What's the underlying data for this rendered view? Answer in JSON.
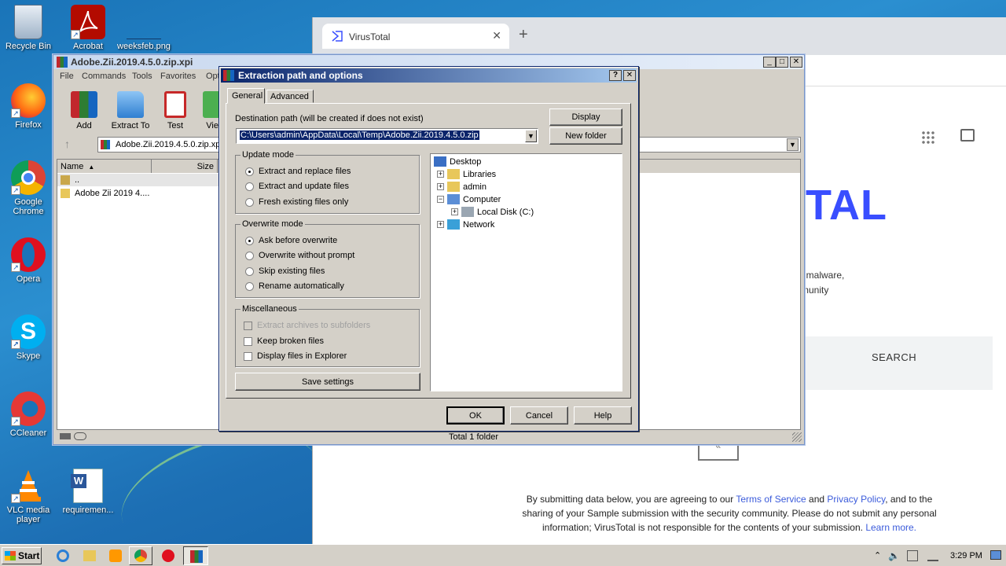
{
  "desktop": {
    "icons": [
      {
        "label": "Recycle Bin",
        "icon": "recycle-bin-icon"
      },
      {
        "label": "Acrobat",
        "icon": "acrobat-icon"
      },
      {
        "label": "weeksfeb.png",
        "icon": "image-file-icon"
      },
      {
        "label": "Firefox",
        "icon": "firefox-icon"
      },
      {
        "label": "Google Chrome",
        "icon": "chrome-icon"
      },
      {
        "label": "Opera",
        "icon": "opera-icon"
      },
      {
        "label": "Skype",
        "icon": "skype-icon"
      },
      {
        "label": "CCleaner",
        "icon": "ccleaner-icon"
      },
      {
        "label": "VLC media player",
        "icon": "vlc-icon"
      },
      {
        "label": "requiremen...",
        "icon": "word-doc-icon"
      }
    ]
  },
  "browser": {
    "tab_title": "VirusTotal",
    "logo_text": "TAL",
    "text1": "f malware,",
    "text2": "munity",
    "search_label": "SEARCH",
    "footer_line1_a": "By submitting data below, you are agreeing to our ",
    "footer_tos": "Terms of Service",
    "footer_and": " and ",
    "footer_privacy": "Privacy Policy",
    "footer_line1_b": ", and to the",
    "footer_line2": "sharing of your Sample submission with the security community. Please do not submit any personal",
    "footer_line3_a": "information; VirusTotal is not responsible for the contents of your submission. ",
    "footer_learn": "Learn more."
  },
  "winrar": {
    "title": "Adobe.Zii.2019.4.5.0.zip.xpi",
    "menu": [
      "File",
      "Commands",
      "Tools",
      "Favorites",
      "Opti"
    ],
    "toolbar": [
      {
        "label": "Add",
        "icon": "add-archive-icon"
      },
      {
        "label": "Extract To",
        "icon": "extract-folder-icon"
      },
      {
        "label": "Test",
        "icon": "test-clipboard-icon"
      },
      {
        "label": "Vie",
        "icon": "view-book-icon"
      }
    ],
    "path": "Adobe.Zii.2019.4.5.0.zip.xp",
    "columns": {
      "name": "Name",
      "size": "Size"
    },
    "files": [
      {
        "name": ".."
      },
      {
        "name": "Adobe Zii 2019 4...."
      }
    ],
    "status": "Total 1 folder"
  },
  "dialog": {
    "title": "Extraction path and options",
    "help_btn": "?",
    "close_btn": "✕",
    "tabs": [
      "General",
      "Advanced"
    ],
    "dest_label": "Destination path (will be created if does not exist)",
    "dest_value": "C:\\Users\\admin\\AppData\\Local\\Temp\\Adobe.Zii.2019.4.5.0.zip",
    "display_btn": "Display",
    "new_folder_btn": "New folder",
    "update_mode": {
      "title": "Update mode",
      "options": [
        "Extract and replace files",
        "Extract and update files",
        "Fresh existing files only"
      ],
      "selected": 0
    },
    "overwrite_mode": {
      "title": "Overwrite mode",
      "options": [
        "Ask before overwrite",
        "Overwrite without prompt",
        "Skip existing files",
        "Rename automatically"
      ],
      "selected": 0
    },
    "misc": {
      "title": "Miscellaneous",
      "options": [
        "Extract archives to subfolders",
        "Keep broken files",
        "Display files in Explorer"
      ]
    },
    "save_settings": "Save settings",
    "tree": [
      "Desktop",
      "Libraries",
      "admin",
      "Computer",
      "Local Disk (C:)",
      "Network"
    ],
    "ok": "OK",
    "cancel": "Cancel",
    "help": "Help"
  },
  "taskbar": {
    "start": "Start",
    "time": "3:29 PM"
  },
  "colors": {
    "vt_blue": "#394eff",
    "dialog_title": "#0a246a",
    "link": "#3b5bdb"
  }
}
